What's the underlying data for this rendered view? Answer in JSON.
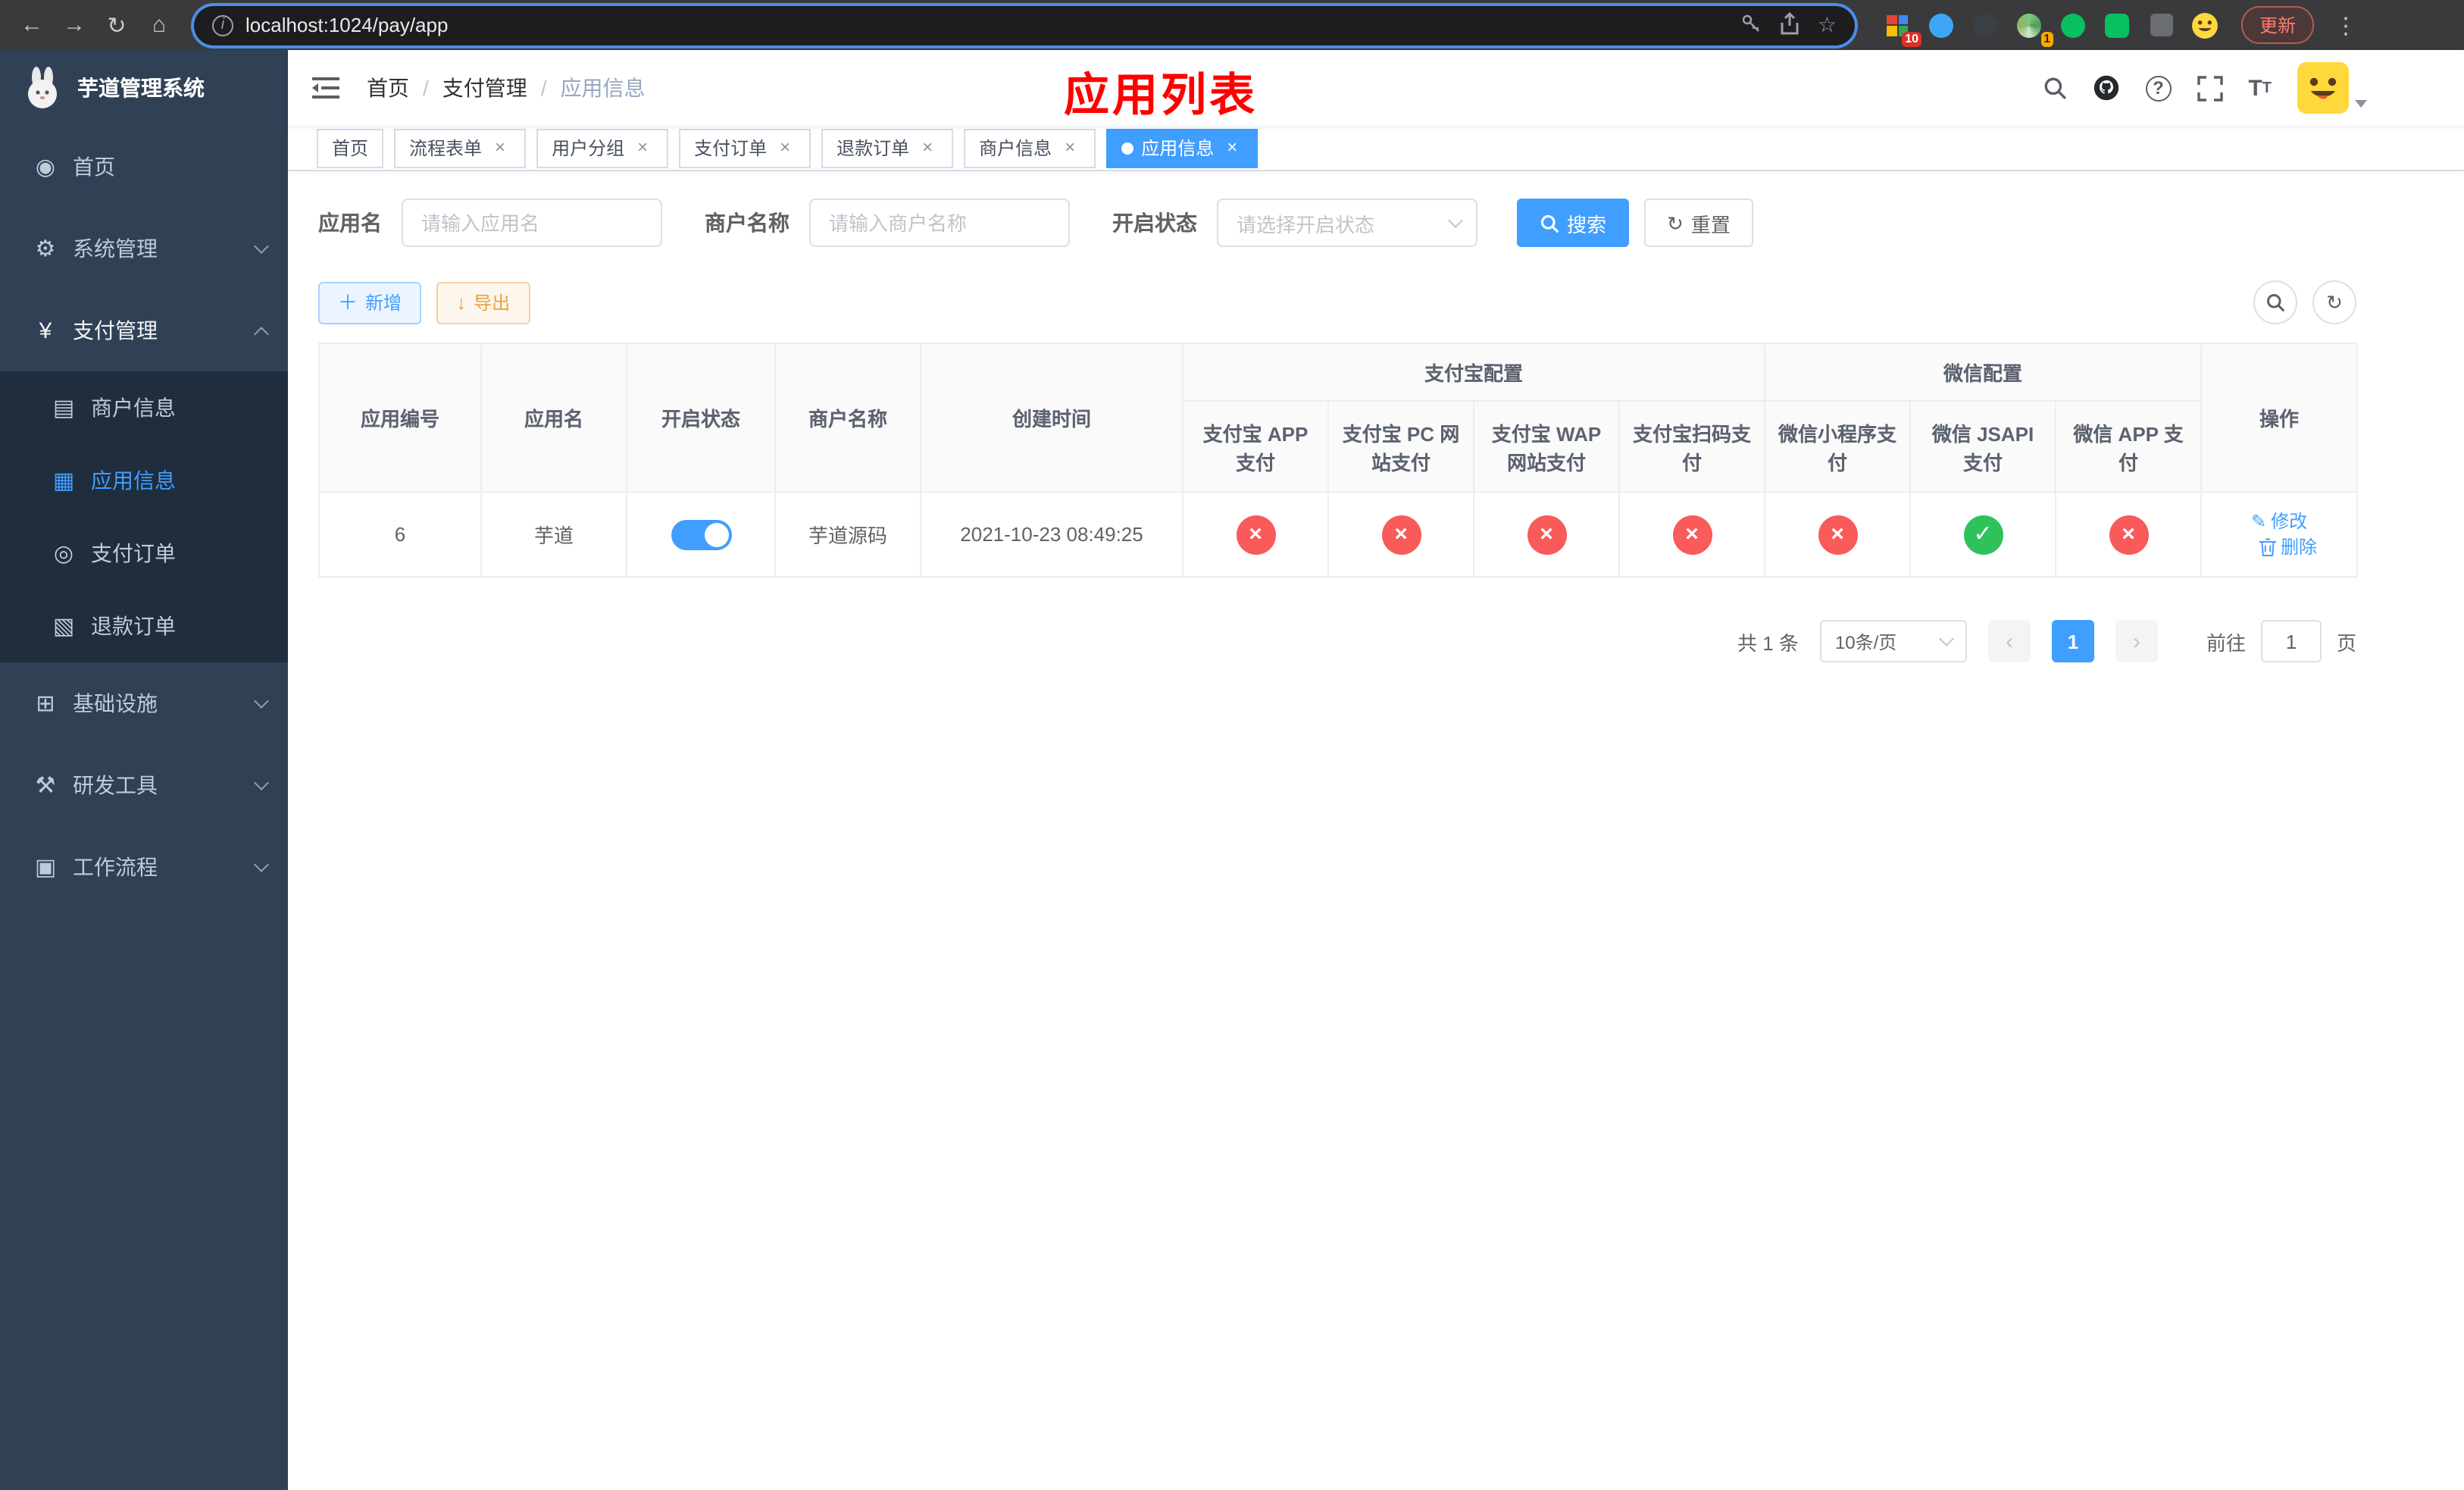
{
  "browser": {
    "url": "localhost:1024/pay/app",
    "update_button": "更新",
    "ext_badge_grid": "10",
    "ext_badge_avatar": "1"
  },
  "sidebar": {
    "title": "芋道管理系统",
    "menu": {
      "home": "首页",
      "system": "系统管理",
      "pay": "支付管理",
      "merchant": "商户信息",
      "app": "应用信息",
      "order": "支付订单",
      "refund": "退款订单",
      "infra": "基础设施",
      "dev": "研发工具",
      "workflow": "工作流程"
    }
  },
  "navbar": {
    "breadcrumb": [
      "首页",
      "支付管理",
      "应用信息"
    ],
    "overlay_title": "应用列表"
  },
  "tags": [
    {
      "label": "首页"
    },
    {
      "label": "流程表单"
    },
    {
      "label": "用户分组"
    },
    {
      "label": "支付订单"
    },
    {
      "label": "退款订单"
    },
    {
      "label": "商户信息"
    },
    {
      "label": "应用信息"
    }
  ],
  "filters": {
    "app_name": {
      "label": "应用名",
      "placeholder": "请输入应用名"
    },
    "merchant": {
      "label": "商户名称",
      "placeholder": "请输入商户名称"
    },
    "status": {
      "label": "开启状态",
      "placeholder": "请选择开启状态"
    },
    "search": "搜索",
    "reset": "重置"
  },
  "toolbar": {
    "add": "新增",
    "export": "导出"
  },
  "table": {
    "headers": {
      "id": "应用编号",
      "name": "应用名",
      "status": "开启状态",
      "merchant": "商户名称",
      "created": "创建时间",
      "alipay_group": "支付宝配置",
      "wechat_group": "微信配置",
      "alipay_app": "支付宝 APP 支付",
      "alipay_pc": "支付宝 PC 网站支付",
      "alipay_wap": "支付宝 WAP 网站支付",
      "alipay_qr": "支付宝扫码支付",
      "wx_lite": "微信小程序支付",
      "wx_jsapi": "微信 JSAPI 支付",
      "wx_app": "微信 APP 支付",
      "actions": "操作"
    },
    "rows": [
      {
        "id": "6",
        "name": "芋道",
        "enabled": true,
        "merchant": "芋道源码",
        "created": "2021-10-23 08:49:25",
        "configs": [
          false,
          false,
          false,
          false,
          false,
          true,
          false
        ],
        "edit": "修改",
        "delete": "删除"
      }
    ]
  },
  "pagination": {
    "total": "共 1 条",
    "size": "10条/页",
    "page": "1",
    "goto": "前往",
    "goto_value": "1",
    "unit": "页"
  },
  "icons": {
    "check": "✓",
    "cross": "×"
  },
  "colors": {
    "primary": "#409EFF",
    "success": "#2fc25b",
    "danger": "#f95a5a",
    "warning": "#e6a23c",
    "title": "#ff0000",
    "sidebar_bg": "#304156"
  }
}
